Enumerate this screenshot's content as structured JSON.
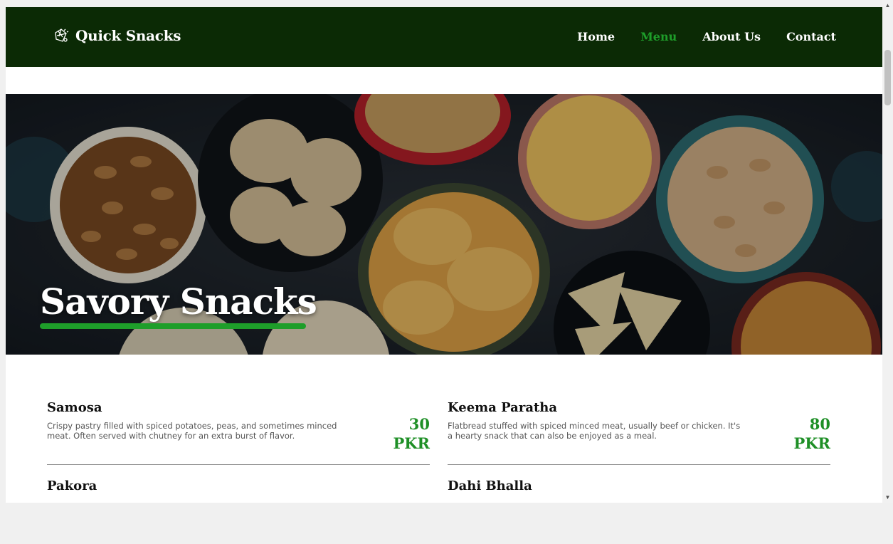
{
  "brand": {
    "name": "Quick Snacks",
    "icon": "snack-logo-icon"
  },
  "nav": {
    "items": [
      {
        "label": "Home",
        "active": false
      },
      {
        "label": "Menu",
        "active": true
      },
      {
        "label": "About Us",
        "active": false
      },
      {
        "label": "Contact",
        "active": false
      }
    ]
  },
  "hero": {
    "title": "Savory Snacks"
  },
  "menu": {
    "items": [
      {
        "name": "Samosa",
        "description": "Crispy pastry filled with spiced potatoes, peas, and sometimes minced meat. Often served with chutney for an extra burst of flavor.",
        "price": "30",
        "currency": "PKR"
      },
      {
        "name": "Keema Paratha",
        "description": "Flatbread stuffed with spiced minced meat, usually beef or chicken. It's a hearty snack that can also be enjoyed as a meal.",
        "price": "80",
        "currency": "PKR"
      },
      {
        "name": "Pakora"
      },
      {
        "name": "Dahi Bhalla"
      }
    ]
  },
  "colors": {
    "navbar_bg": "#0b2a05",
    "accent_green": "#1e9e2a",
    "price_green": "#1e8f26"
  }
}
